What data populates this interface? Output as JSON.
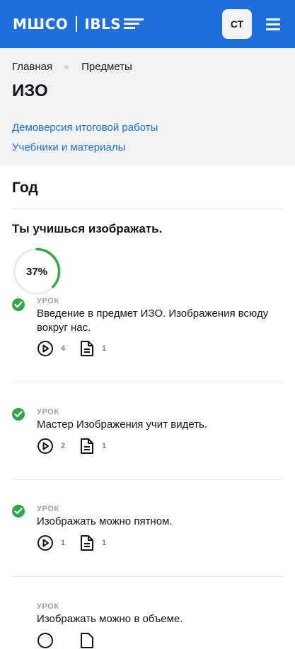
{
  "header": {
    "logo_left": "МШСО",
    "logo_right": "IBLS",
    "avatar_initials": "СТ",
    "brand_color": "#1e6fdb"
  },
  "breadcrumb": {
    "items": [
      "Главная",
      "Предметы"
    ]
  },
  "page": {
    "title": "ИЗО",
    "links": [
      "Демоверсия итоговой работы",
      "Учебники и материалы"
    ]
  },
  "section": {
    "title": "Год"
  },
  "module": {
    "title": "Ты учишься изображать.",
    "progress_label": "37%",
    "progress": 0.37,
    "progress_color": "#2ea84a"
  },
  "lessons": [
    {
      "kind": "УРОК",
      "title": "Введение в предмет ИЗО. Изображения всюду вокруг нас.",
      "videos": "4",
      "docs": "1",
      "completed": true
    },
    {
      "kind": "УРОК",
      "title": "Мастер Изображения учит видеть.",
      "videos": "2",
      "docs": "1",
      "completed": true
    },
    {
      "kind": "УРОК",
      "title": "Изображать можно пятном.",
      "videos": "1",
      "docs": "1",
      "completed": true
    },
    {
      "kind": "УРОК",
      "title": "Изображать можно в объеме.",
      "videos": "",
      "docs": "",
      "completed": false
    }
  ],
  "icons": {
    "menu": "hamburger-menu-icon",
    "check": "check-circle-icon",
    "video": "play-circle-icon",
    "document": "document-icon"
  }
}
